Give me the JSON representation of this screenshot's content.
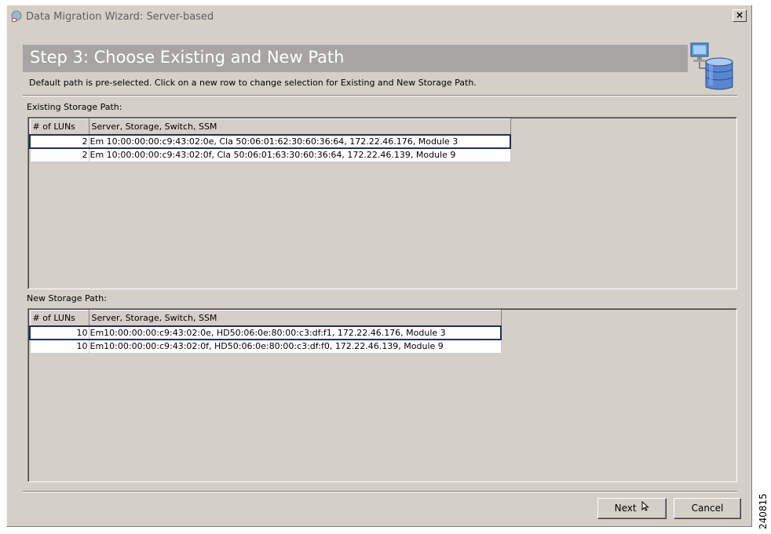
{
  "window": {
    "title": "Data Migration Wizard: Server-based",
    "close_label": "×"
  },
  "step": {
    "title": "Step 3: Choose Existing and New Path",
    "description": "Default path is pre-selected. Click on a new row to change selection for Existing and New Storage Path."
  },
  "existing": {
    "label": "Existing Storage Path:",
    "columns": [
      "# of LUNs",
      "Server, Storage, Switch, SSM"
    ],
    "rows": [
      {
        "luns": "2",
        "path": "Em 10:00:00:00:c9:43:02:0e, Cla 50:06:01:62:30:60:36:64, 172.22.46.176, Module 3",
        "selected": true
      },
      {
        "luns": "2",
        "path": "Em 10:00:00:00:c9:43:02:0f, Cla 50:06:01:63:30:60:36:64, 172.22.46.139, Module 9",
        "selected": false
      }
    ]
  },
  "new_path": {
    "label": "New Storage Path:",
    "columns": [
      "# of LUNs",
      "Server, Storage, Switch, SSM"
    ],
    "rows": [
      {
        "luns": "10",
        "path": "Em10:00:00:00:c9:43:02:0e, HD50:06:0e:80:00:c3:df:f1, 172.22.46.176, Module 3",
        "selected": true
      },
      {
        "luns": "10",
        "path": "Em10:00:00:00:c9:43:02:0f, HD50:06:0e:80:00:c3:df:f0, 172.22.46.139, Module 9",
        "selected": false
      }
    ]
  },
  "buttons": {
    "next": "Next",
    "cancel": "Cancel"
  },
  "side_number": "240815",
  "icons": {
    "title": "java-app-icon",
    "banner": "computer-database-icon",
    "next": "cursor-arrow-icon"
  },
  "colors": {
    "dialog_bg": "#d4d0c8",
    "banner_bg": "#a6a5a3",
    "banner_text": "#ffffff",
    "title_text": "#5f5f5f",
    "selection_border": "#1f2f5f"
  }
}
